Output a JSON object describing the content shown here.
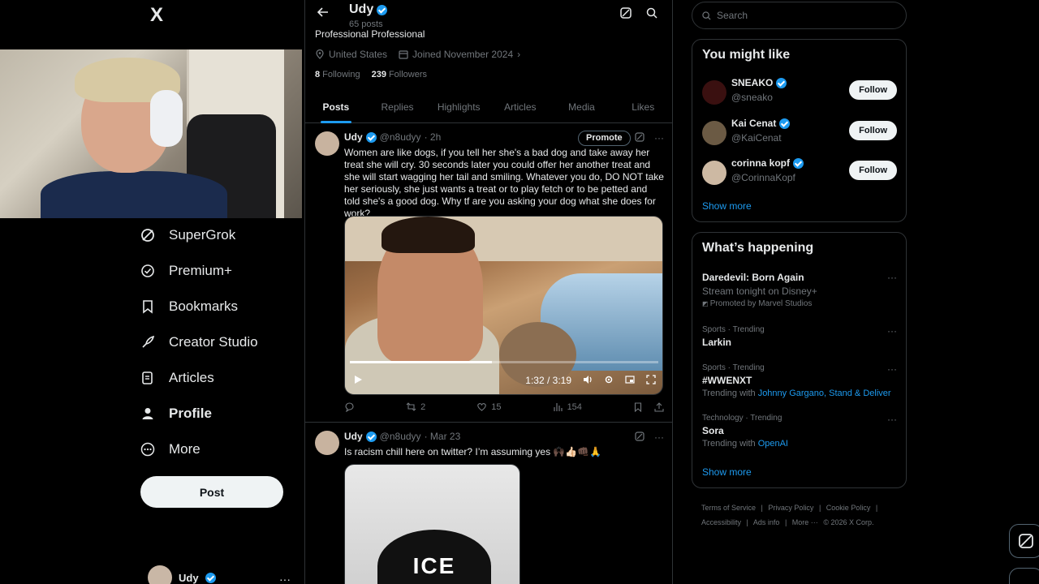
{
  "app": {
    "logo": "X"
  },
  "nav": {
    "items": [
      {
        "label": "SuperGrok",
        "icon": "grok-icon"
      },
      {
        "label": "Premium+",
        "icon": "premium-icon"
      },
      {
        "label": "Bookmarks",
        "icon": "bookmark-icon"
      },
      {
        "label": "Creator Studio",
        "icon": "rocket-icon"
      },
      {
        "label": "Articles",
        "icon": "articles-icon"
      },
      {
        "label": "Profile",
        "icon": "profile-icon"
      },
      {
        "label": "More",
        "icon": "more-icon"
      }
    ],
    "post_label": "Post",
    "account_name": "Udy",
    "account_more": "···"
  },
  "profile": {
    "name": "Udy",
    "post_count": "65 posts",
    "bio": "Professional Professional",
    "location": "United States",
    "joined": "Joined November 2024",
    "following_count": "8",
    "following_label": "Following",
    "followers_count": "239",
    "followers_label": "Followers",
    "tabs": [
      "Posts",
      "Replies",
      "Highlights",
      "Articles",
      "Media",
      "Likes"
    ]
  },
  "tweets": [
    {
      "name": "Udy",
      "handle": "@n8udyy",
      "time": "· 2h",
      "promote": "Promote",
      "text": "Women are like dogs, if you tell her she's a bad dog and take away her treat she will cry. 30 seconds later you could offer her another treat and she will start wagging her tail and smiling. Whatever you do, DO NOT take her seriously, she just wants a treat or to play fetch or to be petted and told she's a good dog. Why tf are you asking your dog what she does for work?",
      "video_time": "1:32 / 3:19",
      "progress_fraction": 0.46,
      "retweets": "2",
      "likes": "15",
      "views": "154"
    },
    {
      "name": "Udy",
      "handle": "@n8udyy",
      "time": "· Mar 23",
      "text": "Is racism chill here on twitter? I’m assuming yes 🙌🏿👍🏻👊🏿🙏",
      "image_text": "ICE"
    }
  ],
  "search": {
    "placeholder": "Search"
  },
  "who_to_follow": {
    "title": "You might like",
    "people": [
      {
        "name": "SNEAKO",
        "handle": "@sneako",
        "follow": "Follow",
        "avatar_color": "#3a1010"
      },
      {
        "name": "Kai Cenat",
        "handle": "@KaiCenat",
        "follow": "Follow",
        "avatar_color": "#6b5a44"
      },
      {
        "name": "corinna kopf",
        "handle": "@CorinnaKopf",
        "follow": "Follow",
        "avatar_color": "#cdb9a3"
      }
    ],
    "show_more": "Show more"
  },
  "happening": {
    "title": "What’s happening",
    "trends": [
      {
        "category": "",
        "title": "Daredevil: Born Again",
        "sub": "Stream tonight on Disney+",
        "promo": "Promoted by Marvel Studios"
      },
      {
        "category": "Sports · Trending",
        "title": "Larkin",
        "sub": "",
        "links": ""
      },
      {
        "category": "Sports · Trending",
        "title": "#WWENXT",
        "sub": "Trending with",
        "links": "Johnny Gargano, Stand & Deliver"
      },
      {
        "category": "Technology · Trending",
        "title": "Sora",
        "sub": "Trending with",
        "links": "OpenAI"
      }
    ],
    "show_more": "Show more"
  },
  "footer": {
    "links": [
      "Terms of Service",
      "|",
      "Privacy Policy",
      "|",
      "Cookie Policy",
      "|",
      "Accessibility",
      "|",
      "Ads info",
      "|",
      "More ···",
      "© 2026 X Corp."
    ]
  },
  "colors": {
    "accent": "#1d9bf0",
    "background": "#000000",
    "border": "#2f3336",
    "muted": "#71767b"
  }
}
